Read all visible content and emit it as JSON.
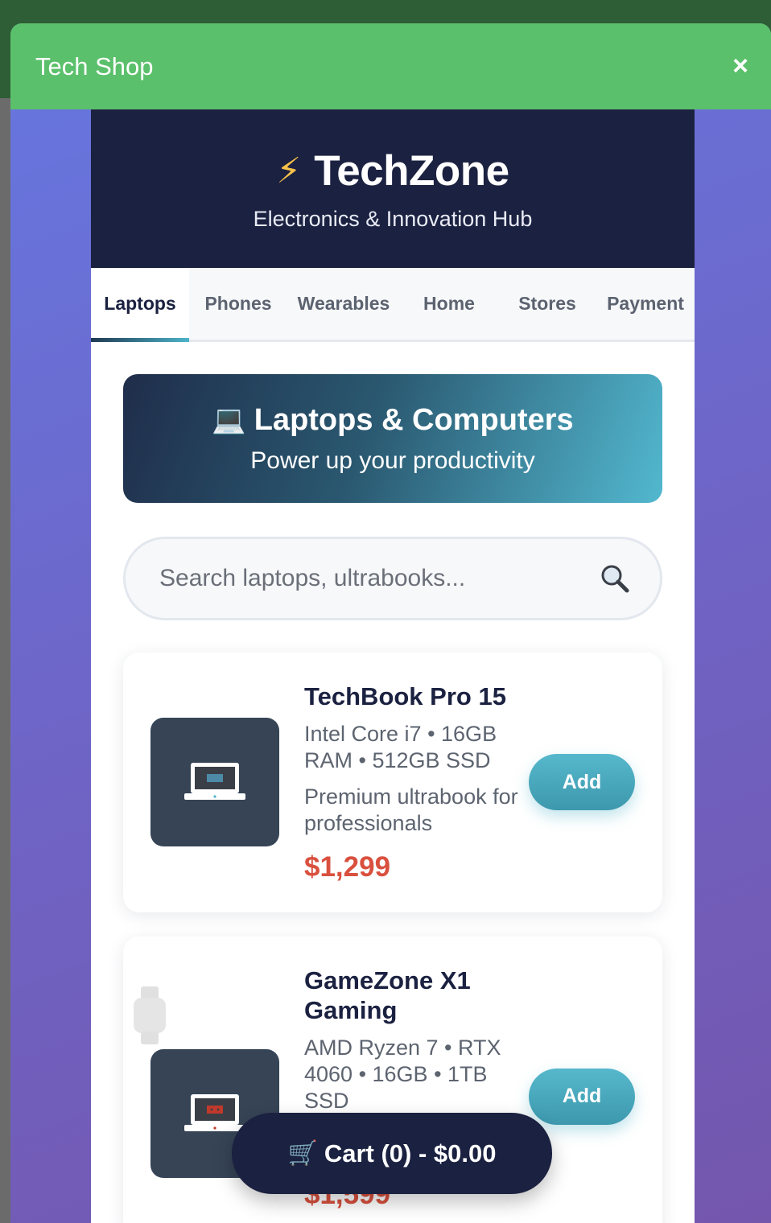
{
  "window": {
    "title": "Tech Shop",
    "close_symbol": "×"
  },
  "hero": {
    "icon": "⚡",
    "brand": "TechZone",
    "subtitle": "Electronics & Innovation Hub"
  },
  "tabs": [
    {
      "label": "Laptops",
      "active": true
    },
    {
      "label": "Phones",
      "active": false
    },
    {
      "label": "Wearables",
      "active": false
    },
    {
      "label": "Home",
      "active": false
    },
    {
      "label": "Stores",
      "active": false
    },
    {
      "label": "Payment",
      "active": false
    }
  ],
  "banner": {
    "icon": "💻",
    "title": "Laptops & Computers",
    "subtitle": "Power up your productivity"
  },
  "search": {
    "placeholder": "Search laptops, ultrabooks...",
    "value": "",
    "icon": "search-icon"
  },
  "products": [
    {
      "name": "TechBook Pro 15",
      "specs": "Intel Core i7 • 16GB RAM • 512GB SSD",
      "description": "Premium ultrabook for professionals",
      "price": "$1,299",
      "button": "Add",
      "screen_color": "#4c8aa8"
    },
    {
      "name": "GameZone X1 Gaming",
      "specs": "AMD Ryzen 7 • RTX 4060 • 16GB • 1TB SSD",
      "description": "",
      "price": "$1,599",
      "button": "Add",
      "screen_color": "#c0392b"
    }
  ],
  "cart": {
    "icon": "🛒",
    "label": "Cart (0) - $0.00"
  },
  "colors": {
    "header_green": "#5bc06b",
    "navy": "#1b2140",
    "accent_teal": "#4cb3c9",
    "price_red": "#d9503e"
  }
}
